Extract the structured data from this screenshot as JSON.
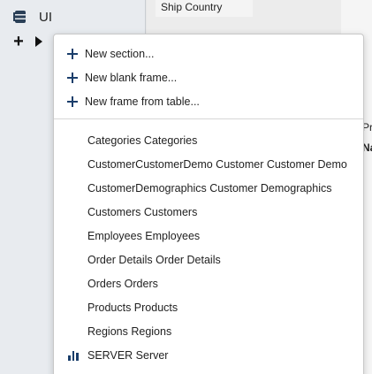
{
  "left": {
    "header_label": "UI"
  },
  "mid": {
    "field_row": "Ship Country"
  },
  "right": {
    "frag1": "Pro",
    "frag2": "Na"
  },
  "menu": {
    "actions": [
      {
        "label": "New section..."
      },
      {
        "label": "New blank frame..."
      },
      {
        "label": "New frame from table..."
      }
    ],
    "tables": [
      {
        "label": "Categories Categories"
      },
      {
        "label": "CustomerCustomerDemo Customer Customer Demo"
      },
      {
        "label": "CustomerDemographics Customer Demographics"
      },
      {
        "label": "Customers Customers"
      },
      {
        "label": "Employees Employees"
      },
      {
        "label": "Order Details Order Details"
      },
      {
        "label": "Orders Orders"
      },
      {
        "label": "Products Products"
      },
      {
        "label": "Regions Regions"
      },
      {
        "label": "SERVER Server",
        "icon": "bar-chart-icon"
      }
    ]
  },
  "colors": {
    "accent": "#1a3e6b",
    "menu_bg": "#ffffff",
    "left_pane": "#e8ebef"
  }
}
